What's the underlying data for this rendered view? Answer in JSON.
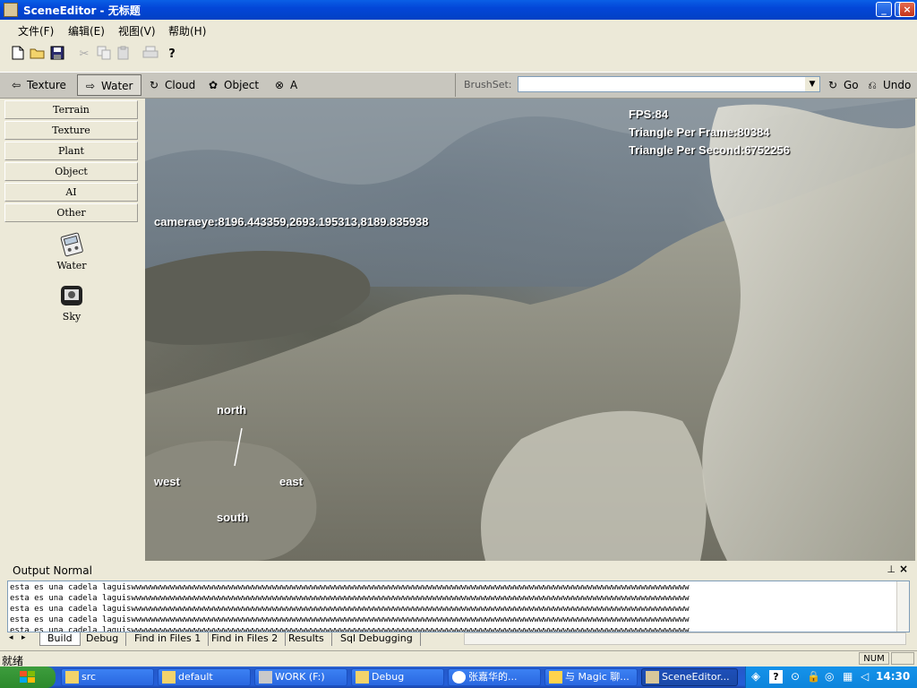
{
  "window": {
    "title": "SceneEditor - 无标题",
    "controls": {
      "minimize": "_",
      "maximize": "□",
      "close": "×"
    }
  },
  "menu": [
    {
      "label": "文件(F)"
    },
    {
      "label": "编辑(E)"
    },
    {
      "label": "视图(V)"
    },
    {
      "label": "帮助(H)"
    }
  ],
  "toolbar": {
    "items": [
      {
        "icon": "new-file-icon",
        "enabled": true
      },
      {
        "icon": "open-folder-icon",
        "enabled": true
      },
      {
        "icon": "save-icon",
        "enabled": true
      },
      {
        "icon": "cut-icon",
        "enabled": false
      },
      {
        "icon": "copy-icon",
        "enabled": false
      },
      {
        "icon": "paste-icon",
        "enabled": false
      },
      {
        "icon": "print-icon",
        "enabled": false
      },
      {
        "icon": "help-icon",
        "enabled": true
      }
    ]
  },
  "modebar": {
    "buttons": [
      {
        "label": "Texture",
        "icon": "arrow-left-icon"
      },
      {
        "label": "Water",
        "icon": "arrow-right-icon",
        "active": true
      },
      {
        "label": "Cloud",
        "icon": "rotate-icon"
      },
      {
        "label": "Object",
        "icon": "object-icon"
      },
      {
        "label": "A",
        "icon": "cross-icon"
      }
    ],
    "brushset_label": "BrushSet:",
    "brushset_value": "",
    "go_label": "Go",
    "undo_label": "Undo"
  },
  "sidebar": {
    "categories": [
      "Terrain",
      "Texture",
      "Plant",
      "Object",
      "AI",
      "Other"
    ],
    "tools": [
      {
        "label": "Water",
        "icon": "water-tool-icon"
      },
      {
        "label": "Sky",
        "icon": "sky-tool-icon"
      }
    ]
  },
  "viewport": {
    "fps": "FPS:84",
    "triangles_per_frame": "Triangle Per Frame:80384",
    "triangles_per_second": "Triangle Per Second:6752256",
    "camera": "cameraeye:8196.443359,2693.195313,8189.835938",
    "compass": {
      "north": "north",
      "west": "west",
      "east": "east",
      "south": "south"
    }
  },
  "output": {
    "title": "Output Normal",
    "lines": [
      "esta es una cadela laguiswwwwwwwwwwwwwwwwwwwwwwwwwwwwwwwwwwwwwwwwwwwwwwwwwwwwwwwwwwwwwwwwwwwwwwwwwwwwwwwwwwwwwwwwwwwwwwwwwwwwwwwwwwwwwwwwwww",
      "esta es una cadela laguiswwwwwwwwwwwwwwwwwwwwwwwwwwwwwwwwwwwwwwwwwwwwwwwwwwwwwwwwwwwwwwwwwwwwwwwwwwwwwwwwwwwwwwwwwwwwwwwwwwwwwwwwwwwwwwwwwww",
      "esta es una cadela laguiswwwwwwwwwwwwwwwwwwwwwwwwwwwwwwwwwwwwwwwwwwwwwwwwwwwwwwwwwwwwwwwwwwwwwwwwwwwwwwwwwwwwwwwwwwwwwwwwwwwwwwwwwwwwwwwwwww",
      "esta es una cadela laguiswwwwwwwwwwwwwwwwwwwwwwwwwwwwwwwwwwwwwwwwwwwwwwwwwwwwwwwwwwwwwwwwwwwwwwwwwwwwwwwwwwwwwwwwwwwwwwwwwwwwwwwwwwwwwwwwwww",
      "esta es una cadela laguiswwwwwwwwwwwwwwwwwwwwwwwwwwwwwwwwwwwwwwwwwwwwwwwwwwwwwwwwwwwwwwwwwwwwwwwwwwwwwwwwwwwwwwwwwwwwwwwwwwwwwwwwwwwwwwwwwww"
    ],
    "tabs": [
      "Build",
      "Debug",
      "Find in Files 1",
      "Find in Files 2",
      "Results",
      "Sql Debugging"
    ],
    "active_tab": "Build"
  },
  "status": {
    "text": "就绪",
    "num": "NUM"
  },
  "taskbar": {
    "tasks": [
      {
        "label": "src",
        "icon": "folder-icon"
      },
      {
        "label": "default",
        "icon": "folder-icon"
      },
      {
        "label": "WORK (F:)",
        "icon": "drive-icon"
      },
      {
        "label": "Debug",
        "icon": "folder-icon"
      },
      {
        "label": "张嘉华的...",
        "icon": "chat-icon"
      },
      {
        "label": "与 Magic 聊...",
        "icon": "chat-icon"
      },
      {
        "label": "SceneEditor...",
        "icon": "app-icon",
        "active": true
      }
    ],
    "clock": "14:30"
  },
  "colors": {
    "titlebar": "#0346d8",
    "taskbar": "#245ed8",
    "tray": "#0d84dc",
    "start": "#2c8a2c",
    "chrome": "#ece9d8"
  }
}
